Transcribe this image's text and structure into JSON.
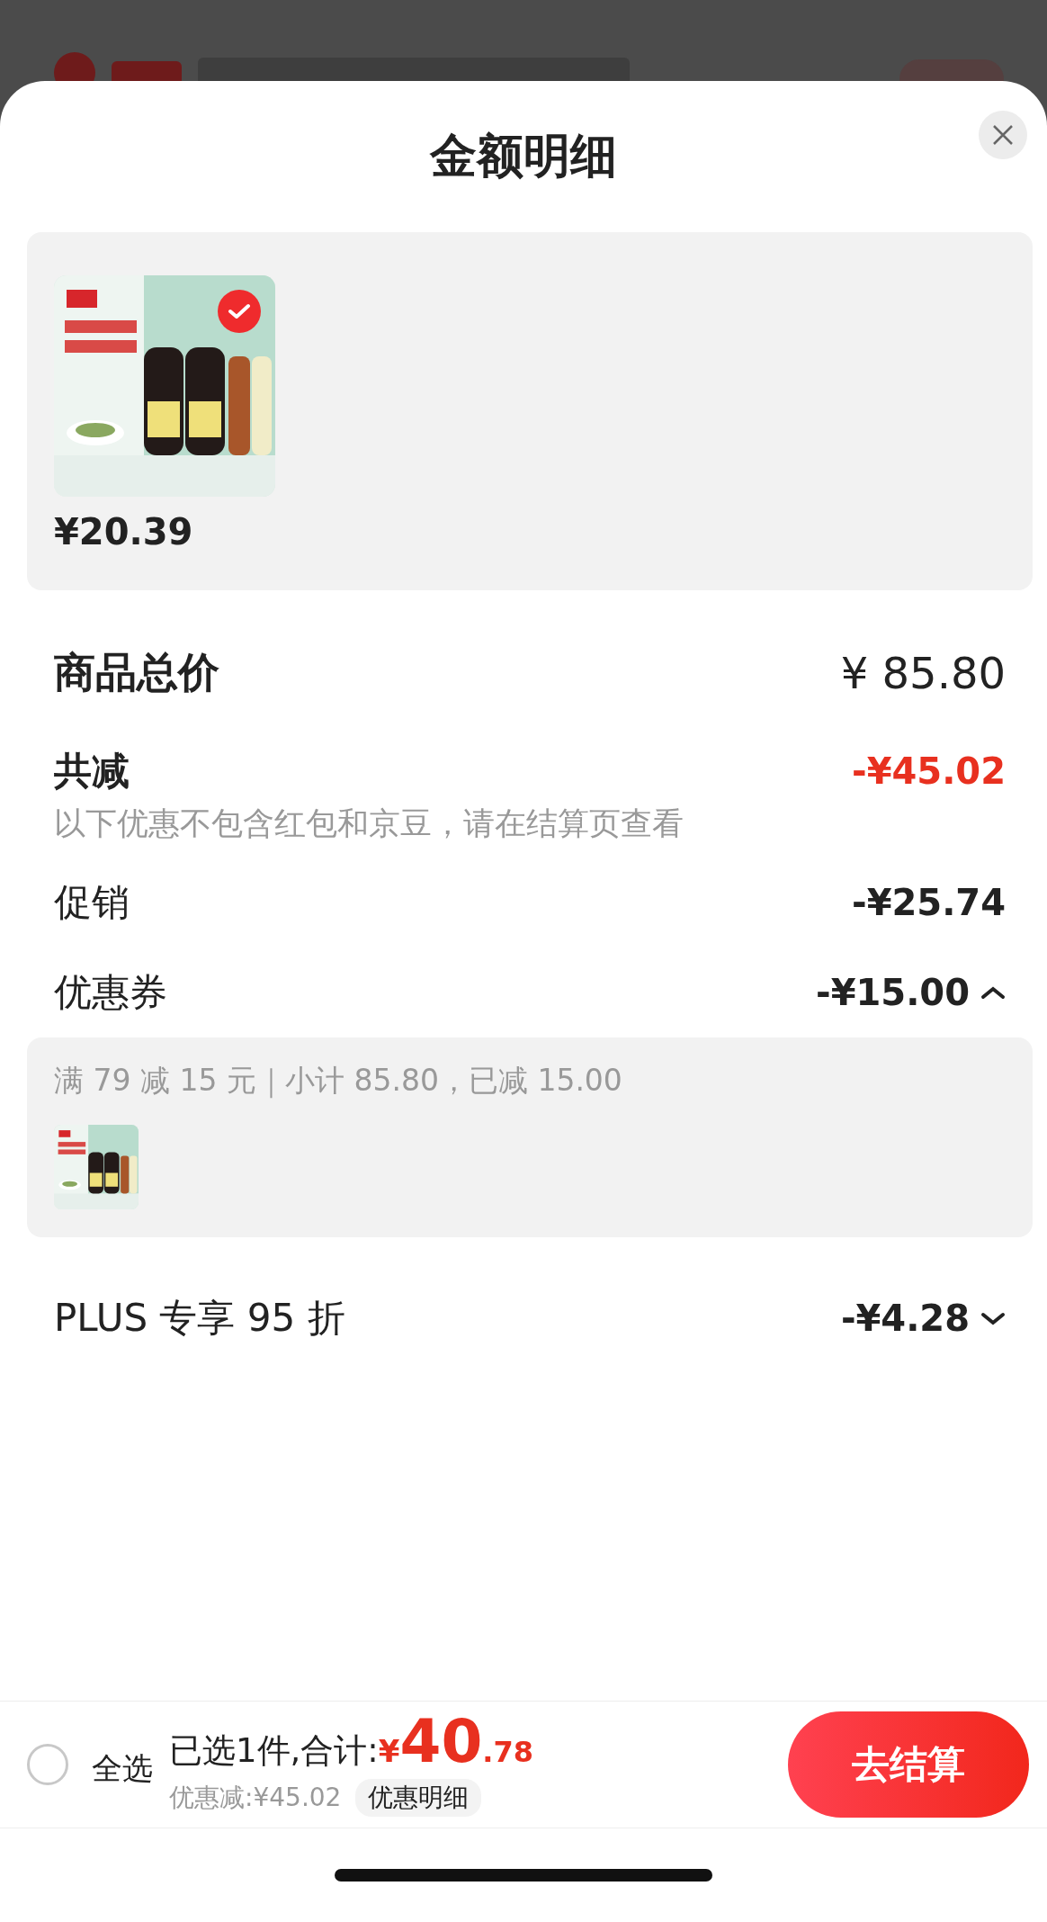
{
  "sheet": {
    "title": "金额明细"
  },
  "items": [
    {
      "kind": "picture",
      "selected": true,
      "price": "¥20.39"
    }
  ],
  "summary": [
    {
      "kind": "total",
      "label": "商品总价",
      "value": "¥ 85.80"
    },
    {
      "kind": "reduce",
      "label": "共减",
      "value": "-¥45.02",
      "note": "以下优惠不包含红包和京豆，请在结算页查看"
    },
    {
      "kind": "line",
      "label": "促销",
      "value": "-¥25.74"
    },
    {
      "kind": "toggle",
      "label": "优惠券",
      "value": "-¥15.00",
      "expanded": true,
      "detail": "满 79 减 15 元｜小计 85.80，已减 15.00"
    },
    {
      "kind": "toggle",
      "label": "PLUS 专享 95 折",
      "value": "-¥4.28",
      "expanded": false
    }
  ],
  "footer": {
    "select_all": {
      "label": "全选",
      "checked": false
    },
    "selected_text": "已选1件,合计:",
    "currency": "¥",
    "amount_int": "40",
    "amount_dec": ".78",
    "discount": "优惠减:¥45.02",
    "detail_link": "优惠明细",
    "checkout": "去结算"
  }
}
